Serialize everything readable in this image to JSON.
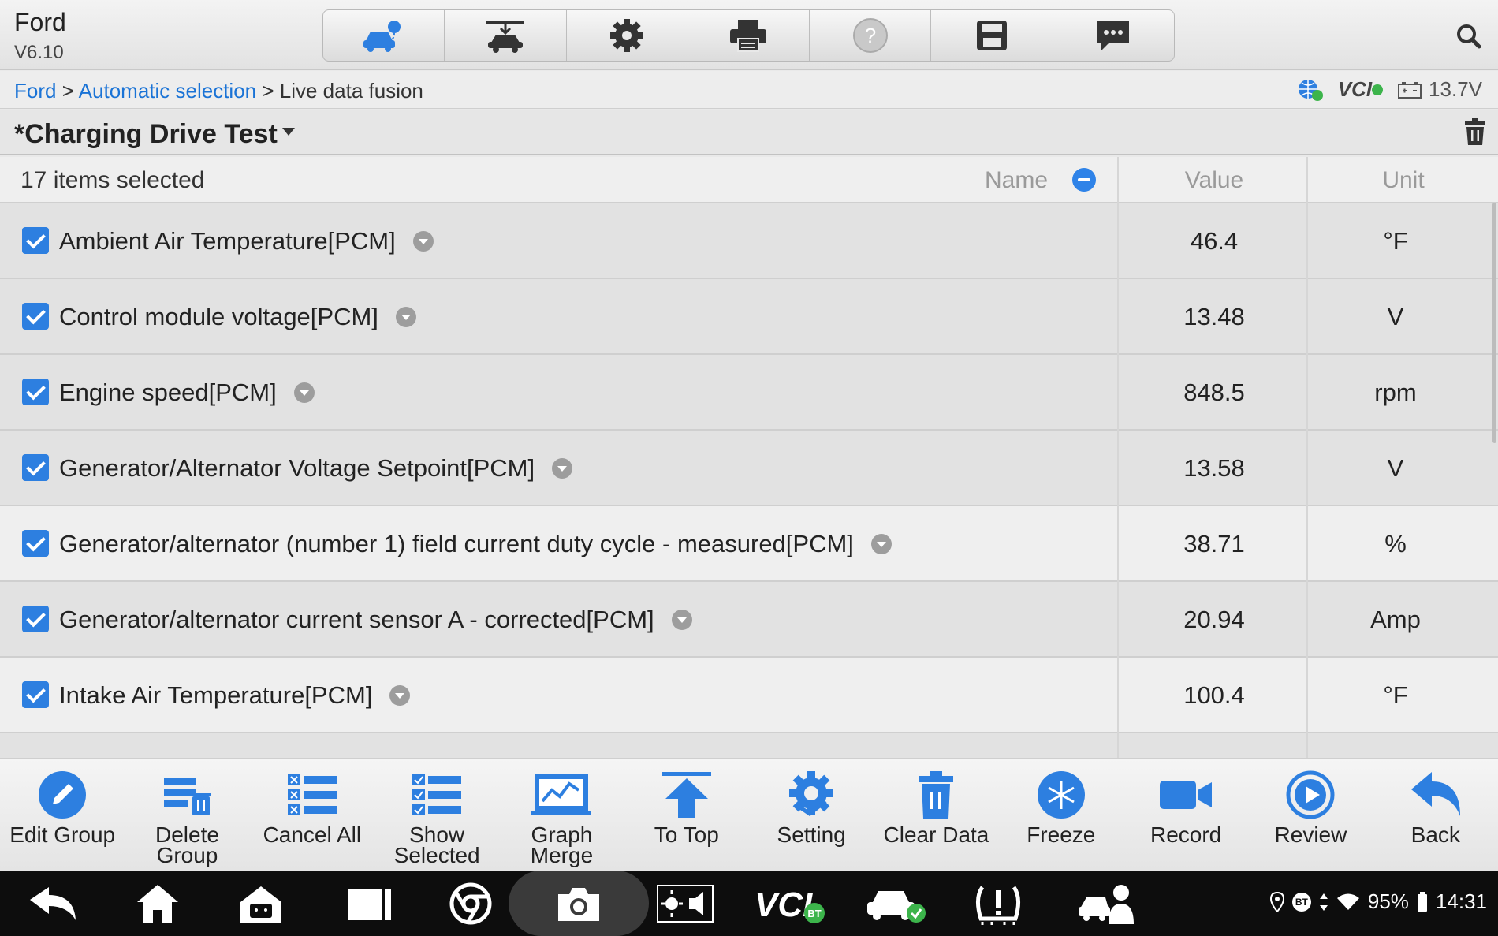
{
  "app": {
    "make": "Ford",
    "version": "V6.10"
  },
  "toolbar": {
    "icons": [
      "vehicle-diagnostics-icon",
      "vehicle-lift-icon",
      "settings-gear-icon",
      "printer-icon",
      "help-icon",
      "save-icon",
      "message-icon"
    ]
  },
  "breadcrumb": {
    "root": "Ford",
    "sep1": " > ",
    "mid": "Automatic selection",
    "sep2": " > ",
    "current": "Live data fusion"
  },
  "status": {
    "vci": "VCI",
    "battery_voltage": "13.7V"
  },
  "page": {
    "title": "*Charging Drive Test"
  },
  "table": {
    "count_label": "17 items selected",
    "col_name": "Name",
    "col_value": "Value",
    "col_unit": "Unit",
    "rows": [
      {
        "name": "Ambient Air Temperature[PCM]",
        "value": "46.4",
        "unit": "°F"
      },
      {
        "name": "Control module voltage[PCM]",
        "value": "13.48",
        "unit": "V"
      },
      {
        "name": "Engine speed[PCM]",
        "value": "848.5",
        "unit": "rpm"
      },
      {
        "name": "Generator/Alternator Voltage Setpoint[PCM]",
        "value": "13.58",
        "unit": "V"
      },
      {
        "name": "Generator/alternator (number 1) field current duty cycle - measured[PCM]",
        "value": "38.71",
        "unit": "%"
      },
      {
        "name": "Generator/alternator current sensor A - corrected[PCM]",
        "value": "20.94",
        "unit": "Amp"
      },
      {
        "name": "Intake Air Temperature[PCM]",
        "value": "100.4",
        "unit": "°F"
      }
    ]
  },
  "actions": {
    "edit_group": "Edit Group",
    "delete_group": "Delete\nGroup",
    "cancel_all": "Cancel All",
    "show_selected": "Show\nSelected",
    "graph_merge": "Graph\nMerge",
    "to_top": "To Top",
    "setting": "Setting",
    "clear_data": "Clear Data",
    "freeze": "Freeze",
    "record": "Record",
    "review": "Review",
    "back": "Back"
  },
  "system": {
    "battery": "95%",
    "time": "14:31",
    "bt": "BT"
  },
  "colors": {
    "accent": "#2d7fe0",
    "link": "#1a73d6",
    "navbar": "#0d0d0d"
  }
}
